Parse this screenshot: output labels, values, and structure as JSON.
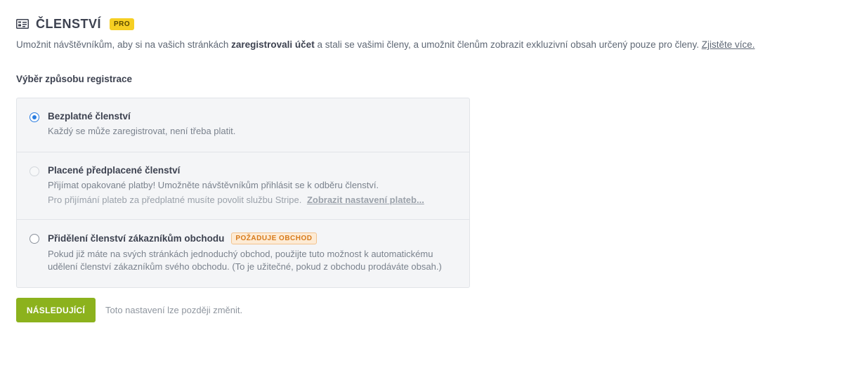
{
  "header": {
    "icon": "id-card-icon",
    "title": "ČLENSTVÍ",
    "badge": "PRO",
    "badge_color": "#f6cf23"
  },
  "intro": {
    "text_before": "Umožnit návštěvníkům, aby si na vašich stránkách ",
    "text_bold": "zaregistrovali účet",
    "text_after": " a stali se vašimi členy, a umožnit členům zobrazit exkluzivní obsah určený pouze pro členy. ",
    "link": "Zjistěte více."
  },
  "section_label": "Výběr způsobu registrace",
  "options": [
    {
      "title": "Bezplatné členství",
      "description": "Každý se může zaregistrovat, není třeba platit.",
      "state": "checked"
    },
    {
      "title": "Placené předplacené členství",
      "description": "Přijímat opakované platby! Umožněte návštěvníkům přihlásit se k odběru členství.",
      "note": "Pro přijímání plateb za předplatné musíte povolit službu Stripe.",
      "note_link": "Zobrazit nastavení plateb...",
      "state": "disabled"
    },
    {
      "title": "Přidělení členství zákazníkům obchodu",
      "badge": "POŽADUJE OBCHOD",
      "description": "Pokud již máte na svých stránkách jednoduchý obchod, použijte tuto možnost k automatickému udělení členství zákazníkům svého obchodu. (To je užitečné, pokud z obchodu prodáváte obsah.)",
      "state": "unchecked"
    }
  ],
  "footer": {
    "button_label": "NÁSLEDUJÍCÍ",
    "button_color": "#8cb21d",
    "note": "Toto nastavení lze později změnit."
  },
  "accent_color": "#2b7de0"
}
